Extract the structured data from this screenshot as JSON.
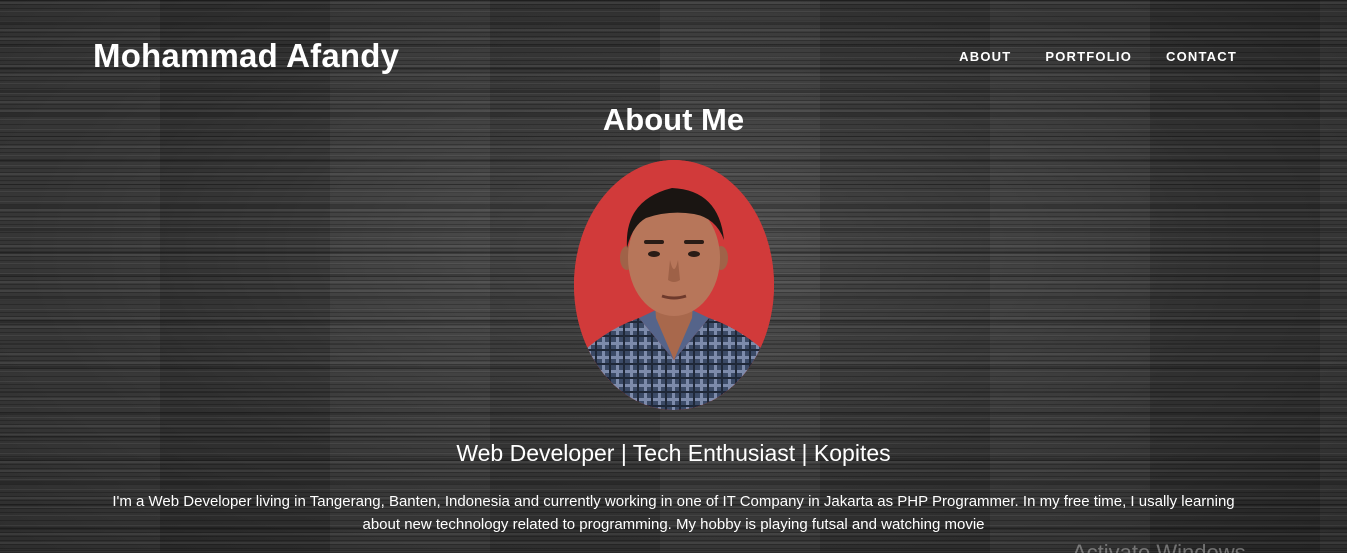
{
  "header": {
    "brand": "Mohammad Afandy",
    "nav": [
      {
        "label": "ABOUT"
      },
      {
        "label": "PORTFOLIO"
      },
      {
        "label": "CONTACT"
      }
    ]
  },
  "about": {
    "title": "About Me",
    "photo": "profile-photo",
    "tagline": "Web Developer | Tech Enthusiast | Kopites",
    "bio": "I'm a Web Developer living in Tangerang, Banten, Indonesia and currently working in one of IT Company in Jakarta as PHP Programmer. In my free time, I usally learning about new technology related to programming. My hobby is playing futsal and watching movie"
  },
  "overlay": {
    "watermark": "Activate Windows"
  },
  "colors": {
    "text": "#ffffff",
    "photo_background": "#d13a3a",
    "page_background": "#3a3a3a"
  }
}
